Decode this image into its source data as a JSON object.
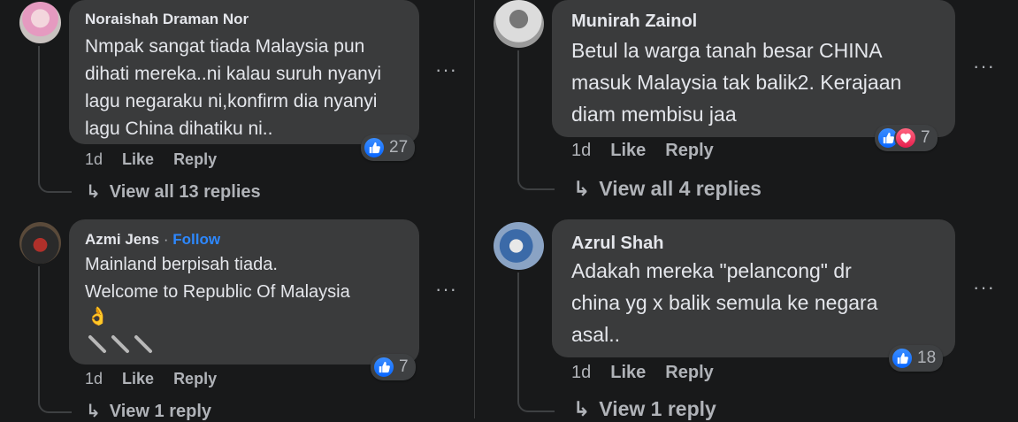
{
  "comments": [
    {
      "name": "Noraishah Draman Nor",
      "text": "Nmpak sangat tiada Malaysia pun\ndihati mereka..ni kalau suruh nyanyi\nlagu negaraku ni,konfirm dia nyanyi\nlagu China dihatiku ni..",
      "time": "1d",
      "like": "Like",
      "reply": "Reply",
      "reactions": "27",
      "replies": "View all 13 replies",
      "more": "···",
      "avatar_colors": [
        "#c9c2c0",
        "#e59ac0"
      ]
    },
    {
      "name": "Azmi Jens",
      "follow_sep": "·",
      "follow": "Follow",
      "text": "Mainland berpisah tiada.\nWelcome to Republic Of Malaysia",
      "emoji": "👌",
      "time": "1d",
      "like": "Like",
      "reply": "Reply",
      "reactions": "7",
      "replies": "View 1 reply",
      "more": "···",
      "avatar_colors": [
        "#2a2a2a",
        "#b0302a"
      ]
    },
    {
      "name": "Munirah Zainol",
      "text": "Betul la warga tanah besar CHINA\nmasuk Malaysia tak balik2. Kerajaan\ndiam membisu jaa",
      "time": "1d",
      "like": "Like",
      "reply": "Reply",
      "reactions": "7",
      "replies": "View all 4 replies",
      "more": "···",
      "avatar_colors": [
        "#dcdcdc",
        "#555555"
      ]
    },
    {
      "name": "Azrul Shah",
      "text": "Adakah mereka \"pelancong\" dr\nchina yg x balik semula ke negara\nasal..",
      "time": "1d",
      "like": "Like",
      "reply": "Reply",
      "reactions": "18",
      "replies": "View 1 reply",
      "more": "···",
      "avatar_colors": [
        "#8aa3c4",
        "#3b6aa8"
      ]
    }
  ],
  "reply_arrow": "↳",
  "colors": {
    "like": "#0866ff",
    "love": "#e61e4d",
    "follow": "#2d88ff",
    "bubble": "#3a3b3c",
    "background": "#18191a"
  }
}
